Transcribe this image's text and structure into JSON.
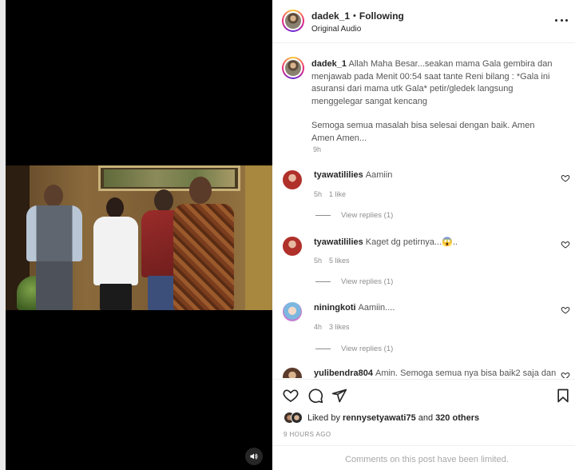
{
  "post": {
    "author": "dadek_1",
    "separator": "•",
    "follow_status": "Following",
    "audio": "Original Audio"
  },
  "caption": {
    "author": "dadek_1",
    "paragraph1": "Allah Maha Besar...seakan mama Gala gembira dan menjawab pada Menit 00:54 saat tante Reni bilang : *Gala ini asuransi dari mama utk Gala* petir/gledek langsung menggelegar sangat kencang",
    "paragraph2": "Semoga semua masalah bisa selesai dengan baik. Amen Amen Amen...",
    "time": "9h"
  },
  "comments": [
    {
      "user": "tyawatililies",
      "text": "Aamiin",
      "time": "5h",
      "likes": "1 like",
      "replies": "View replies (1)"
    },
    {
      "user": "tyawatililies",
      "text": "Kaget dg petirnya...😱..",
      "time": "5h",
      "likes": "5 likes",
      "replies": "View replies (1)"
    },
    {
      "user": "niningkoti",
      "text": "Aamiin....",
      "time": "4h",
      "likes": "3 likes",
      "replies": "View replies (1)"
    },
    {
      "user": "yulibendra804",
      "text": "Amin. Semoga semua nya bisa baik2 saja dan"
    }
  ],
  "likes": {
    "prefix": "Liked by",
    "user": "rennysetyawati75",
    "conjunction": "and",
    "others": "320 others"
  },
  "time_ago": "9 HOURS AGO",
  "comments_limited": "Comments on this post have been limited.",
  "icons": {
    "more": "more-horizontal-icon",
    "like": "heart-icon",
    "comment": "comment-icon",
    "share": "paper-plane-icon",
    "save": "bookmark-icon",
    "volume": "speaker-icon"
  },
  "colors": {
    "text": "#262626",
    "secondary": "#8e8e8e",
    "border": "#efefef",
    "media_bg": "#000000"
  }
}
